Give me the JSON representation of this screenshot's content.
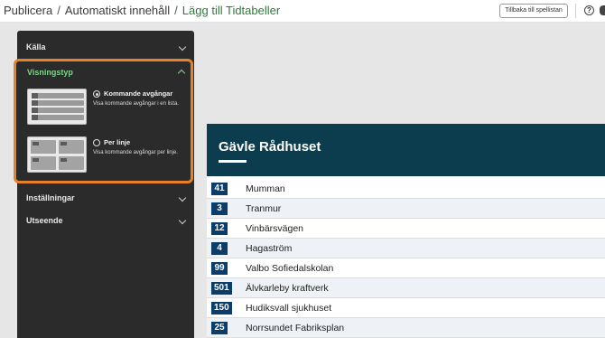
{
  "breadcrumb": {
    "items": [
      "Publicera",
      "Automatiskt innehåll",
      "Lägg till Tidtabeller"
    ],
    "separator": "/"
  },
  "header": {
    "back_button": "Tillbaka till spellistan",
    "help_icon": "?"
  },
  "sidebar": {
    "sections": [
      {
        "label": "Källa",
        "expanded": false
      },
      {
        "label": "Visningstyp",
        "expanded": true
      },
      {
        "label": "Inställningar",
        "expanded": false
      },
      {
        "label": "Utseende",
        "expanded": false
      }
    ],
    "display_options": [
      {
        "title": "Kommande avgångar",
        "description": "Visa kommande avgångar i en lista.",
        "selected": true
      },
      {
        "title": "Per linje",
        "description": "Visa kommande avgångar per linje.",
        "selected": false
      }
    ]
  },
  "preview": {
    "title": "Gävle Rådhuset",
    "rows": [
      {
        "line": "41",
        "destination": "Mumman"
      },
      {
        "line": "3",
        "destination": "Tranmur"
      },
      {
        "line": "12",
        "destination": "Vinbärsvägen"
      },
      {
        "line": "4",
        "destination": "Hagaström"
      },
      {
        "line": "99",
        "destination": "Valbo Sofiedalskolan"
      },
      {
        "line": "501",
        "destination": "Älvkarleby kraftverk"
      },
      {
        "line": "150",
        "destination": "Hudiksvall sjukhuset"
      },
      {
        "line": "25",
        "destination": "Norrsundet Fabriksplan"
      }
    ]
  },
  "colors": {
    "accent_green": "#2f7a3a",
    "highlight_orange": "#e8822a",
    "preview_header": "#0b3d4f",
    "badge": "#0b3d6b"
  }
}
